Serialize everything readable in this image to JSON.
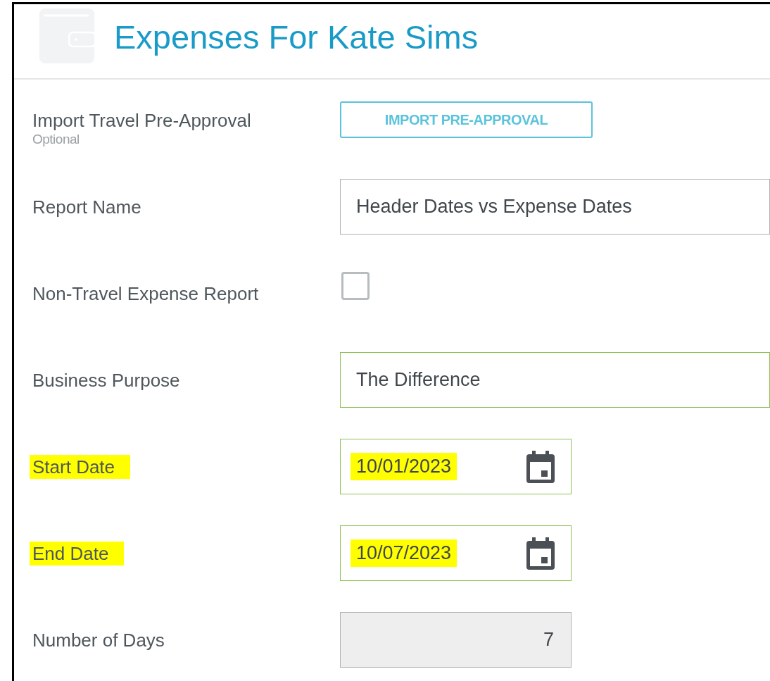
{
  "header": {
    "title": "Expenses For Kate Sims"
  },
  "rows": [
    {
      "label": "Import Travel Pre-Approval",
      "hint": "Optional",
      "highlighted": false,
      "control": {
        "kind": "button",
        "text": "IMPORT PRE-APPROVAL"
      }
    },
    {
      "label": "Report Name",
      "highlighted": false,
      "control": {
        "kind": "text",
        "value": "Header Dates vs Expense Dates",
        "valid": false
      }
    },
    {
      "label": "Non-Travel Expense Report",
      "highlighted": false,
      "control": {
        "kind": "checkbox",
        "checked": false
      }
    },
    {
      "label": "Business Purpose",
      "highlighted": false,
      "control": {
        "kind": "text",
        "value": "The Difference",
        "valid": true
      }
    },
    {
      "label": "Start Date",
      "highlighted": true,
      "control": {
        "kind": "date",
        "value": "10/01/2023",
        "valid": true,
        "highlighted": true
      }
    },
    {
      "label": "End Date",
      "highlighted": true,
      "control": {
        "kind": "date",
        "value": "10/07/2023",
        "valid": true,
        "highlighted": true
      }
    },
    {
      "label": "Number of Days",
      "highlighted": false,
      "control": {
        "kind": "readonly",
        "value": "7"
      }
    }
  ]
}
